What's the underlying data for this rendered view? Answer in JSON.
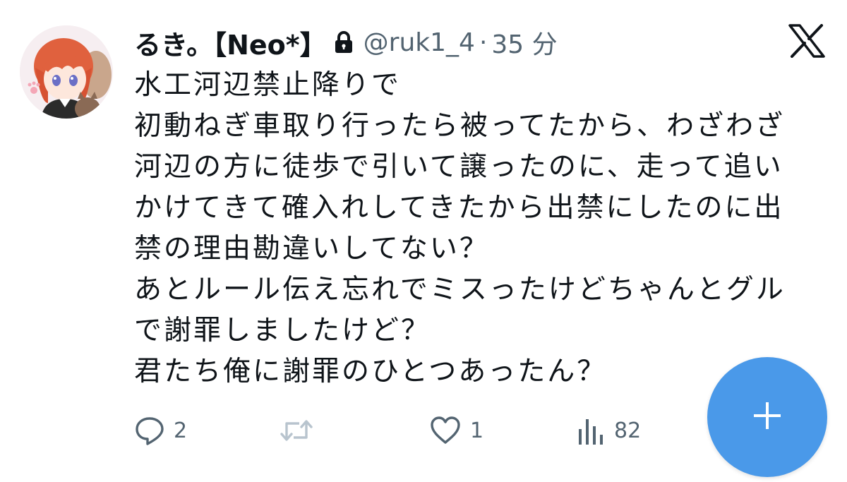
{
  "tweet": {
    "display_name": "るき。【Neo*】",
    "handle": "@ruk1_4",
    "separator": "·",
    "time": "35 分",
    "lines": [
      "水工河辺禁止降りで",
      "初動ねぎ車取り行ったら被ってたから、わざわざ",
      "河辺の方に徒歩で引いて譲ったのに、走って追い",
      "かけてきて確入れしてきたから出禁にしたのに出",
      "禁の理由勘違いしてない？",
      "あとルール伝え忘れでミスったけどちゃんとグル",
      "で謝罪しましたけど？",
      "君たち俺に謝罪のひとつあったん？"
    ]
  },
  "actions": {
    "reply_count": "2",
    "retweet_count": "",
    "like_count": "1",
    "views_count": "82"
  },
  "icons": {
    "lock": "lock-icon",
    "x_logo": "x-logo-icon",
    "reply": "reply-icon",
    "retweet": "retweet-icon",
    "like": "heart-icon",
    "views": "bar-chart-icon",
    "compose": "plus-icon"
  },
  "colors": {
    "text": "#0f1419",
    "muted": "#536471",
    "retweet_muted": "#b8c4ce",
    "fab": "#4a99e9",
    "fab_icon": "#ffffff"
  }
}
